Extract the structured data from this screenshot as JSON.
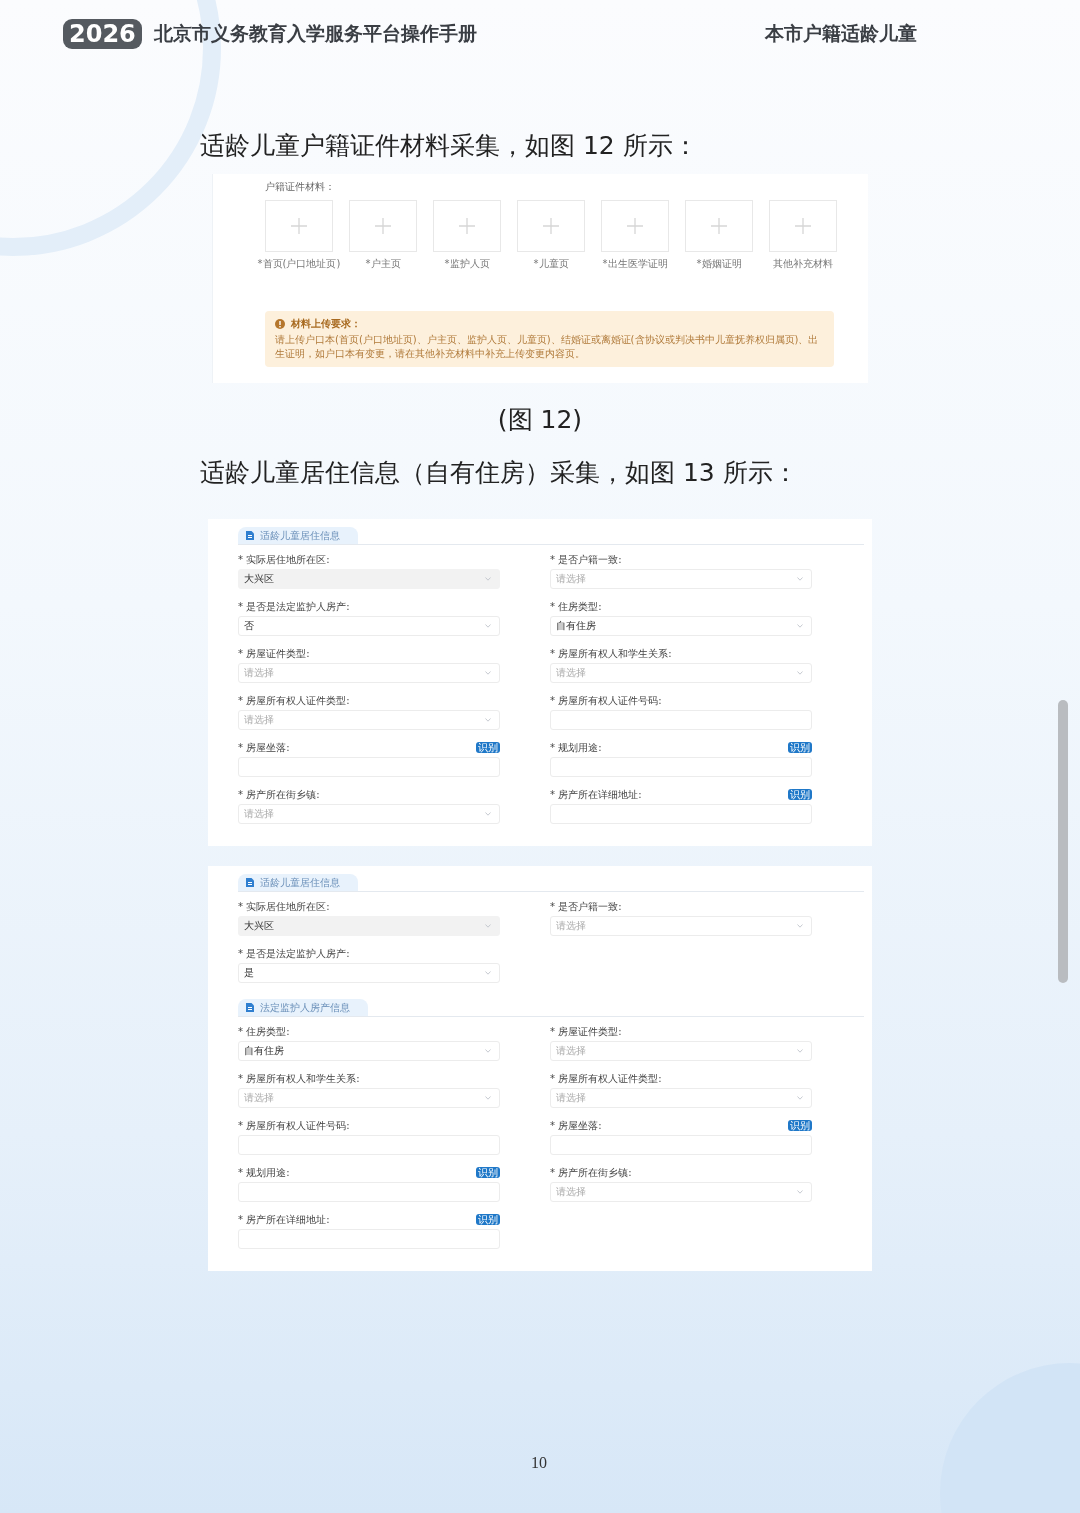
{
  "header": {
    "year": "2026",
    "title": "北京市义务教育入学服务平台操作手册",
    "section": "本市户籍适龄儿童"
  },
  "figure12": {
    "heading": "适龄儿童户籍证件材料采集，如图 12 所示：",
    "group_label": "户籍证件材料：",
    "uploads": [
      {
        "label": "*首页(户口地址页)"
      },
      {
        "label": "*户主页"
      },
      {
        "label": "*监护人页"
      },
      {
        "label": "*儿童页"
      },
      {
        "label": "*出生医学证明"
      },
      {
        "label": "*婚姻证明"
      },
      {
        "label": "其他补充材料"
      }
    ],
    "notice": {
      "title": "材料上传要求：",
      "body": "请上传户口本(首页(户口地址页)、户主页、监护人页、儿童页)、结婚证或离婚证(含协议或判决书中儿童抚养权归属页)、出生证明，如户口本有变更，请在其他补充材料中补充上传变更内容页。"
    },
    "caption": "(图 12)"
  },
  "figure13": {
    "heading": "适龄儿童居住信息（自有住房）采集，如图 13 所示：",
    "panels": [
      {
        "groups": [
          {
            "tab": "适龄儿童居住信息",
            "rows": [
              [
                {
                  "label": "* 实际居住地所在区:",
                  "kind": "select",
                  "value": "大兴区",
                  "disabled": true
                },
                {
                  "label": "* 是否户籍一致:",
                  "kind": "select",
                  "placeholder": "请选择",
                  "disabled": false
                }
              ],
              [
                {
                  "label": "* 是否是法定监护人房产:",
                  "kind": "select",
                  "value": "否",
                  "disabled": false
                },
                {
                  "label": "* 住房类型:",
                  "kind": "select",
                  "value": "自有住房",
                  "disabled": false
                }
              ],
              [
                {
                  "label": "* 房屋证件类型:",
                  "kind": "select",
                  "placeholder": "请选择",
                  "disabled": false
                },
                {
                  "label": "* 房屋所有权人和学生关系:",
                  "kind": "select",
                  "placeholder": "请选择",
                  "disabled": false
                }
              ],
              [
                {
                  "label": "* 房屋所有权人证件类型:",
                  "kind": "select",
                  "placeholder": "请选择",
                  "disabled": false
                },
                {
                  "label": "* 房屋所有权人证件号码:",
                  "kind": "input",
                  "disabled": false
                }
              ],
              [
                {
                  "label": "* 房屋坐落:",
                  "kind": "input",
                  "action": "识别",
                  "disabled": false
                },
                {
                  "label": "* 规划用途:",
                  "kind": "input",
                  "action": "识别",
                  "disabled": false
                }
              ],
              [
                {
                  "label": "* 房产所在街乡镇:",
                  "kind": "select",
                  "placeholder": "请选择",
                  "disabled": false
                },
                {
                  "label": "* 房产所在详细地址:",
                  "kind": "input",
                  "action": "识别",
                  "disabled": false
                }
              ]
            ]
          }
        ]
      },
      {
        "groups": [
          {
            "tab": "适龄儿童居住信息",
            "rows": [
              [
                {
                  "label": "* 实际居住地所在区:",
                  "kind": "select",
                  "value": "大兴区",
                  "disabled": true
                },
                {
                  "label": "* 是否户籍一致:",
                  "kind": "select",
                  "placeholder": "请选择",
                  "disabled": false
                }
              ],
              [
                {
                  "label": "* 是否是法定监护人房产:",
                  "kind": "select",
                  "value": "是",
                  "disabled": false
                }
              ]
            ]
          },
          {
            "tab": "法定监护人房产信息",
            "rows": [
              [
                {
                  "label": "* 住房类型:",
                  "kind": "select",
                  "value": "自有住房",
                  "disabled": false
                },
                {
                  "label": "* 房屋证件类型:",
                  "kind": "select",
                  "placeholder": "请选择",
                  "disabled": false
                }
              ],
              [
                {
                  "label": "* 房屋所有权人和学生关系:",
                  "kind": "select",
                  "placeholder": "请选择",
                  "disabled": false
                },
                {
                  "label": "* 房屋所有权人证件类型:",
                  "kind": "select",
                  "placeholder": "请选择",
                  "disabled": false
                }
              ],
              [
                {
                  "label": "* 房屋所有权人证件号码:",
                  "kind": "input",
                  "disabled": false
                },
                {
                  "label": "* 房屋坐落:",
                  "kind": "input",
                  "action": "识别",
                  "disabled": false
                }
              ],
              [
                {
                  "label": "* 规划用途:",
                  "kind": "input",
                  "action": "识别",
                  "disabled": false
                },
                {
                  "label": "* 房产所在街乡镇:",
                  "kind": "select",
                  "placeholder": "请选择",
                  "disabled": false
                }
              ],
              [
                {
                  "label": "* 房产所在详细地址:",
                  "kind": "input",
                  "action": "识别",
                  "disabled": false
                }
              ]
            ]
          }
        ]
      }
    ]
  },
  "page_number": "10"
}
